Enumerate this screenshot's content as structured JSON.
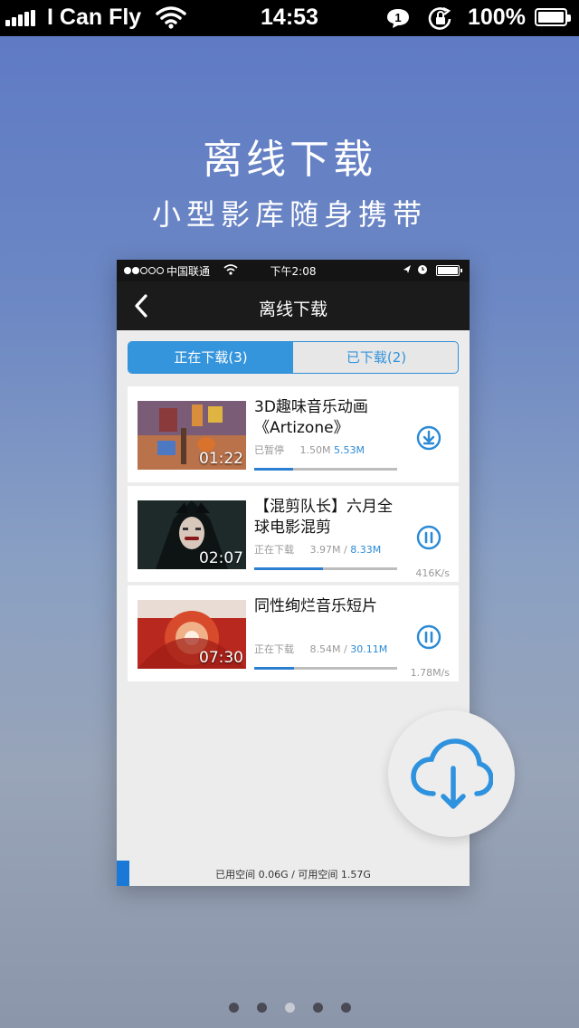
{
  "status_bar": {
    "carrier": "I Can Fly",
    "time": "14:53",
    "notification_count": "1",
    "battery": "100%"
  },
  "headline": {
    "title": "离线下载",
    "subtitle": "小型影库随身携带"
  },
  "phone": {
    "status_bar": {
      "carrier": "中国联通",
      "time": "下午2:08"
    },
    "nav": {
      "title": "离线下载"
    },
    "tabs": [
      {
        "label": "正在下载(3)",
        "active": true
      },
      {
        "label": "已下载(2)",
        "active": false
      }
    ],
    "items": [
      {
        "title": "3D趣味音乐动画《Artizone》",
        "duration": "01:22",
        "status": "已暂停",
        "downloaded": "1.50M",
        "separator": "",
        "total": "5.53M",
        "speed": "",
        "progress": 0.27,
        "action_icon": "download-icon"
      },
      {
        "title": "【混剪队长】六月全球电影混剪",
        "duration": "02:07",
        "status": "正在下载",
        "downloaded": "3.97M",
        "separator": "/",
        "total": "8.33M",
        "speed": "416K/s",
        "progress": 0.48,
        "action_icon": "pause-icon"
      },
      {
        "title": "同性绚烂音乐短片",
        "duration": "07:30",
        "status": "正在下载",
        "downloaded": "8.54M",
        "separator": "/",
        "total": "30.11M",
        "speed": "1.78M/s",
        "progress": 0.28,
        "action_icon": "pause-icon"
      }
    ],
    "storage": {
      "used_label": "已用空间",
      "used": "0.06G",
      "separator": "/",
      "free_label": "可用空间",
      "free": "1.57G"
    }
  },
  "pager": {
    "pages": 5,
    "current": 3
  },
  "colors": {
    "accent": "#3494dc",
    "progress": "#2a7fd0",
    "nav_bg": "#1b1b1b"
  }
}
